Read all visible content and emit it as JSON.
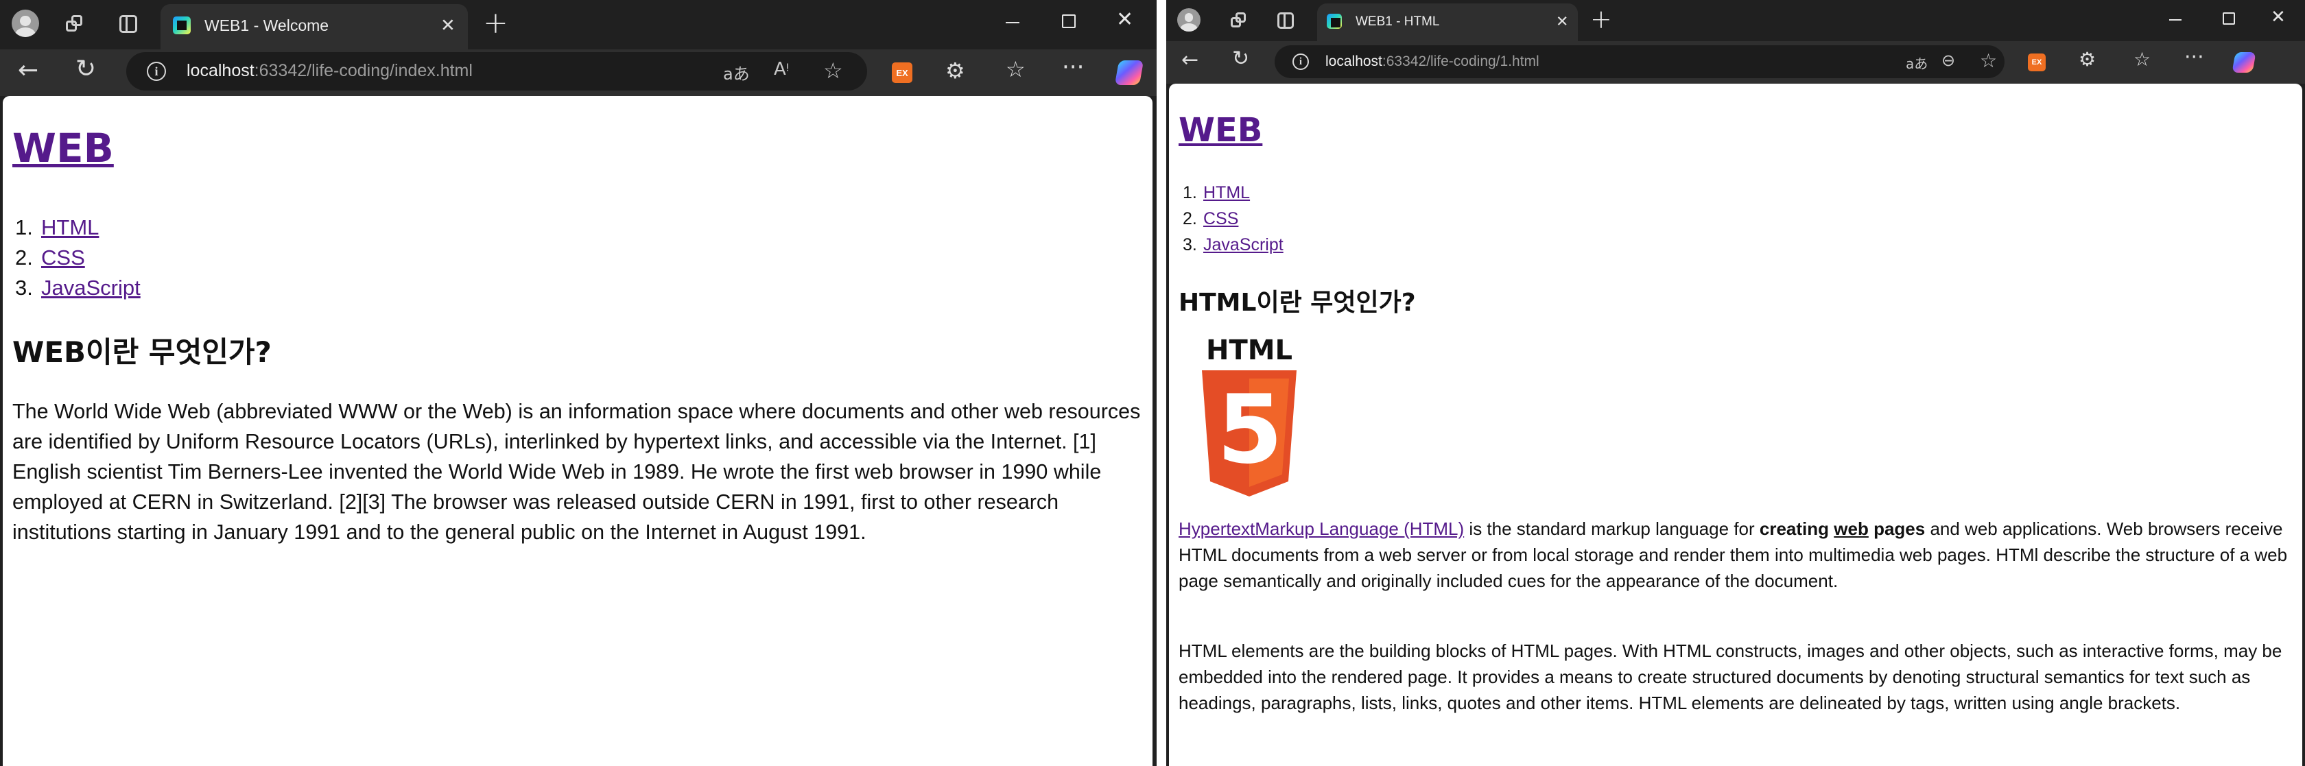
{
  "left": {
    "tab_title": "WEB1 - Welcome",
    "address": {
      "host": "localhost",
      "rest": ":63342/life-coding/index.html"
    },
    "ext_label": "EX",
    "page": {
      "site_title": "WEB",
      "nav": [
        {
          "num": "1.",
          "label": "HTML"
        },
        {
          "num": "2.",
          "label": "CSS"
        },
        {
          "num": "3.",
          "label": "JavaScript"
        }
      ],
      "heading": "WEB이란 무엇인가?",
      "paragraph": "The World Wide Web (abbreviated WWW or the Web) is an information space where documents and other web resources are identified by Uniform Resource Locators (URLs), interlinked by hypertext links, and accessible via the Internet. [1] English scientist Tim Berners-Lee invented the World Wide Web in 1989. He wrote the first web browser in 1990 while employed at CERN in Switzerland. [2][3] The browser was released outside CERN in 1991, first to other research institutions starting in January 1991 and to the general public on the Internet in August 1991."
    }
  },
  "right": {
    "tab_title": "WEB1 - HTML",
    "address": {
      "host": "localhost",
      "rest": ":63342/life-coding/1.html"
    },
    "ext_label": "EX",
    "page": {
      "site_title": "WEB",
      "nav": [
        {
          "num": "1.",
          "label": "HTML"
        },
        {
          "num": "2.",
          "label": "CSS"
        },
        {
          "num": "3.",
          "label": "JavaScript"
        }
      ],
      "heading": "HTML이란 무엇인가?",
      "logo_text": "HTML",
      "logo_digit": "5",
      "p1": {
        "link": "HypertextMarkup Language (HTML)",
        "t1": " is the standard markup language for ",
        "b1": "creating ",
        "b2": "web",
        "b3": " pages",
        "t2": " and web applications. Web browsers receive HTML documents from a web server or from local storage and render them into multimedia web pages. HTMl describe the structure of a web page semantically and originally included cues for the appearance of the document."
      },
      "p2": "HTML elements are the building blocks of HTML pages. With HTML constructs, images and other objects, such as interactive forms, may be embedded into the rendered page. It provides a means to create structured documents by denoting structural semantics for text such as headings, paragraphs, lists, links, quotes and other items. HTML elements are delineated by tags, written using angle brackets."
    }
  },
  "icons": {
    "profile": "profile-avatar-icon",
    "workspaces": "workspaces-icon",
    "vertical_tabs": "tab-actions-icon",
    "back": "back-arrow-icon",
    "refresh": "refresh-icon",
    "info": "site-info-icon",
    "read_aloud": "read-aloud-icon",
    "translate": "translate-icon",
    "favorite": "favorite-star-icon",
    "extensions": "extensions-puzzle-icon",
    "favorites": "favorites-icon",
    "more": "more-menu-icon",
    "copilot": "copilot-icon"
  },
  "colors": {
    "link": "#551a8b",
    "frame": "#202020",
    "toolbar": "#2f2f2f",
    "html5_orange": "#e44d26",
    "html5_light": "#f16529"
  }
}
